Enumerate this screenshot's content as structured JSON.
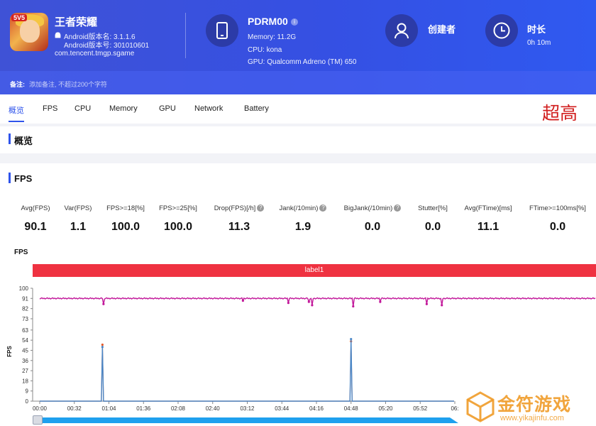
{
  "app": {
    "name": "王者荣耀",
    "badge": "5V5",
    "version_name": "Android版本名: 3.1.1.6",
    "version_code": "Android版本号: 301010601",
    "package": "com.tencent.tmgp.sgame"
  },
  "device": {
    "name": "PDRM00",
    "info_icon": "i",
    "memory": "Memory: 11.2G",
    "cpu": "CPU: kona",
    "gpu": "GPU: Qualcomm Adreno (TM) 650"
  },
  "creator": {
    "label": "创建者"
  },
  "duration": {
    "label": "时长",
    "value": "0h 10m"
  },
  "notes": {
    "label": "备注:",
    "placeholder": "添加备注, 不超过200个字符"
  },
  "tabs": [
    "概览",
    "FPS",
    "CPU",
    "Memory",
    "GPU",
    "Network",
    "Battery"
  ],
  "annotation": "超高",
  "sections": {
    "overview": "概览",
    "fps": "FPS"
  },
  "stats": [
    {
      "label": "Avg(FPS)",
      "value": "90.1",
      "help": false
    },
    {
      "label": "Var(FPS)",
      "value": "1.1",
      "help": false
    },
    {
      "label": "FPS>=18[%]",
      "value": "100.0",
      "help": false
    },
    {
      "label": "FPS>=25[%]",
      "value": "100.0",
      "help": false
    },
    {
      "label": "Drop(FPS)[/h]",
      "value": "11.3",
      "help": true
    },
    {
      "label": "Jank(/10min)",
      "value": "1.9",
      "help": true
    },
    {
      "label": "BigJank(/10min)",
      "value": "0.0",
      "help": true
    },
    {
      "label": "Stutter[%]",
      "value": "0.0",
      "help": false
    },
    {
      "label": "Avg(FTime)[ms]",
      "value": "11.1",
      "help": false
    },
    {
      "label": "FTime>=100ms[%]",
      "value": "0.0",
      "help": false
    }
  ],
  "chart_data": {
    "type": "line",
    "title": "FPS",
    "ylabel": "FPS",
    "band_label": "label1",
    "ylim": [
      0,
      100
    ],
    "yticks": [
      0,
      9,
      18,
      27,
      36,
      45,
      54,
      63,
      73,
      82,
      91,
      100
    ],
    "xticks": [
      "00:00",
      "00:32",
      "01:04",
      "01:36",
      "02:08",
      "02:40",
      "03:12",
      "03:44",
      "04:16",
      "04:48",
      "05:20",
      "05:52",
      "06:"
    ],
    "series": [
      {
        "color": "#c2189a",
        "baseline": 91,
        "dips": [
          {
            "t": "00:59",
            "v": 86
          },
          {
            "t": "03:08",
            "v": 89
          },
          {
            "t": "03:50",
            "v": 87
          },
          {
            "t": "04:09",
            "v": 88
          },
          {
            "t": "04:12",
            "v": 85
          },
          {
            "t": "04:50",
            "v": 84
          },
          {
            "t": "05:15",
            "v": 88
          },
          {
            "t": "05:58",
            "v": 86
          },
          {
            "t": "06:12",
            "v": 85
          }
        ]
      },
      {
        "color": "#4a86c6",
        "baseline": 0,
        "spikes": [
          {
            "t": "00:58",
            "v": 48
          },
          {
            "t": "04:48",
            "v": 55
          }
        ]
      },
      {
        "color": "#e45a2a",
        "baseline": 0,
        "spikes": [
          {
            "t": "00:58",
            "v": 50
          },
          {
            "t": "04:48",
            "v": 53
          }
        ]
      }
    ]
  },
  "watermark": {
    "text": "金符游戏",
    "url": "www.yikajinfu.com"
  },
  "colors": {
    "header": "#3550e3",
    "accent": "#2f54eb",
    "band": "#ef3241",
    "fps_line": "#c2189a",
    "annotation": "#d11d1d"
  }
}
